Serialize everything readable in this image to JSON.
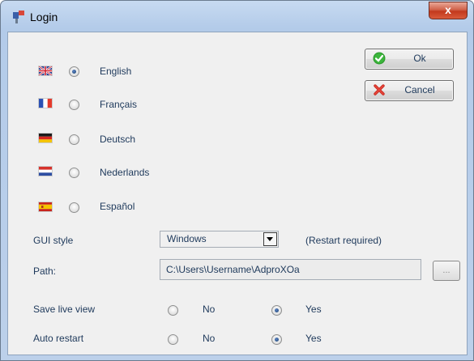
{
  "window": {
    "title": "Login",
    "close_glyph": "x"
  },
  "languages": [
    {
      "label": "English",
      "flag": "uk-flag-icon",
      "selected": true
    },
    {
      "label": "Français",
      "flag": "france-flag-icon",
      "selected": false
    },
    {
      "label": "Deutsch",
      "flag": "germany-flag-icon",
      "selected": false
    },
    {
      "label": "Nederlands",
      "flag": "netherlands-flag-icon",
      "selected": false
    },
    {
      "label": "Español",
      "flag": "spain-flag-icon",
      "selected": false
    }
  ],
  "buttons": {
    "ok": {
      "label": "Ok",
      "icon": "checkmark-icon"
    },
    "cancel": {
      "label": "Cancel",
      "icon": "cross-icon"
    }
  },
  "gui_style": {
    "label": "GUI style",
    "value": "Windows",
    "note": "(Restart required)"
  },
  "path": {
    "label": "Path:",
    "value": "C:\\Users\\Username\\AdproXOa",
    "browse_label": "..."
  },
  "save_live_view": {
    "label": "Save live view",
    "no_label": "No",
    "yes_label": "Yes",
    "selected": "Yes"
  },
  "auto_restart": {
    "label": "Auto restart",
    "no_label": "No",
    "yes_label": "Yes",
    "selected": "Yes"
  },
  "colors": {
    "title_bar": "#c7daf1",
    "close_button": "#c2391d",
    "client_bg": "#f0f0f0",
    "text": "#1e395b"
  }
}
